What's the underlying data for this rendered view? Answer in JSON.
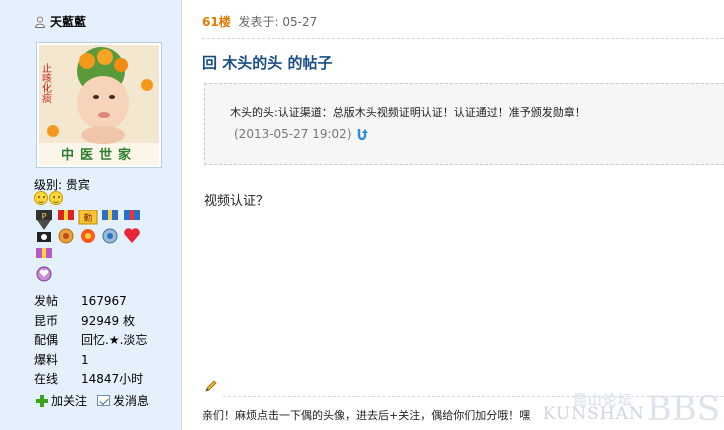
{
  "sidebar": {
    "username": "天藍藍",
    "level_label": "级别:",
    "level_value": "贵宾",
    "stats": [
      {
        "key": "发帖",
        "value": "167967"
      },
      {
        "key": "昆币",
        "value": "92949 枚"
      },
      {
        "key": "配偶",
        "value": "回忆.★.淡忘"
      },
      {
        "key": "爆料",
        "value": "1"
      },
      {
        "key": "在线",
        "value": "14847小时"
      }
    ],
    "follow_label": "加关注",
    "message_label": "发消息",
    "avatar": {
      "caption": "中医世家",
      "side_text": "止咳化痰"
    }
  },
  "post": {
    "floor": "61楼",
    "posted_label": "发表于: 05-27",
    "title": "回 木头的头 的帖子",
    "quote_text": "木头的头:认证渠道：总版木头视频证明认证！认证通过！准予颁发勋章！",
    "quote_time": "(2013-05-27 19:02)",
    "content": "视频认证？",
    "signature": "亲们！麻烦点击一下偶的头像，进去后+关注，偶给你们加分哦！嘿"
  },
  "watermark": {
    "cn": "昆山论坛",
    "en": "KUNSHAN",
    "bbs": "BBS"
  },
  "colors": {
    "sidebar_bg": "#e4f0fb",
    "title_blue": "#1a4f86",
    "floor_orange": "#e07b00",
    "follow_green": "#3aa21b"
  }
}
